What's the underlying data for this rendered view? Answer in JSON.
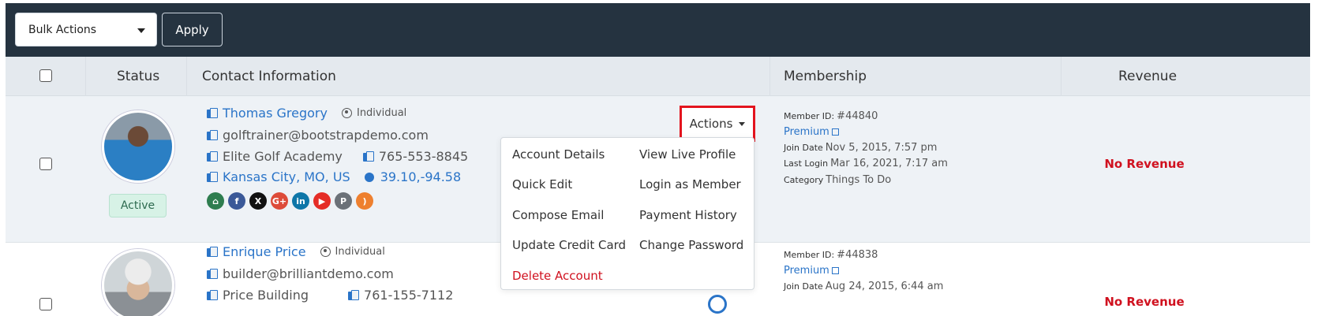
{
  "toolbar": {
    "bulk_actions_label": "Bulk Actions",
    "apply_label": "Apply"
  },
  "table": {
    "headers": [
      "Status",
      "Contact Information",
      "Membership",
      "Revenue"
    ]
  },
  "rows": [
    {
      "name": "Thomas Gregory",
      "type": "Individual",
      "email": "golftrainer@bootstrapdemo.com",
      "company": "Elite Golf Academy",
      "phone": "765-553-8845",
      "location": "Kansas City, MO, US",
      "coords": "39.10,-94.58",
      "status": "Active",
      "member_id_label": "Member ID:",
      "member_id": "#44840",
      "plan": "Premium",
      "join_label": "Join Date",
      "join_date": "Nov 5, 2015, 7:57 pm",
      "login_label": "Last Login",
      "last_login": "Mar 16, 2021, 7:17 am",
      "category_label": "Category",
      "category": "Things To Do",
      "revenue": "No Revenue"
    },
    {
      "name": "Enrique Price",
      "type": "Individual",
      "email": "builder@brilliantdemo.com",
      "company": "Price Building",
      "phone": "761-155-7112",
      "member_id_label": "Member ID:",
      "member_id": "#44838",
      "plan": "Premium",
      "join_label": "Join Date",
      "join_date": "Aug 24, 2015, 6:44 am",
      "revenue": "No Revenue"
    }
  ],
  "socials": [
    {
      "icon": "home-icon",
      "glyph": "⌂",
      "color": "#2e7d4f"
    },
    {
      "icon": "facebook-icon",
      "glyph": "f",
      "color": "#3b5998"
    },
    {
      "icon": "x-icon",
      "glyph": "X",
      "color": "#111111"
    },
    {
      "icon": "google-plus-icon",
      "glyph": "G+",
      "color": "#dd4b39"
    },
    {
      "icon": "linkedin-icon",
      "glyph": "in",
      "color": "#0e76a8"
    },
    {
      "icon": "youtube-icon",
      "glyph": "▶",
      "color": "#e52d27"
    },
    {
      "icon": "pinterest-icon",
      "glyph": "P",
      "color": "#6b7178"
    },
    {
      "icon": "rss-icon",
      "glyph": ")",
      "color": "#ee802f"
    }
  ],
  "actions": {
    "button_label": "Actions",
    "menu": {
      "account_details": "Account Details",
      "view_live_profile": "View Live Profile",
      "quick_edit": "Quick Edit",
      "login_as_member": "Login as Member",
      "compose_email": "Compose Email",
      "payment_history": "Payment History",
      "update_credit_card": "Update Credit Card",
      "change_password": "Change Password",
      "delete_account": "Delete Account"
    }
  },
  "colors": {
    "toolbar_bg": "#253340",
    "link": "#2a74c8",
    "danger": "#d0111f",
    "highlight_border": "#e3141e",
    "active_badge_bg": "#d7f2e6"
  }
}
